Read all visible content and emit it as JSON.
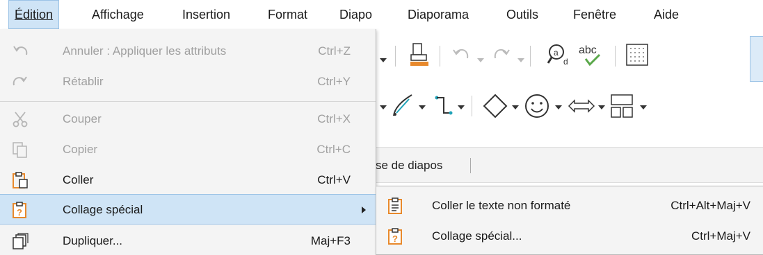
{
  "menubar": {
    "items": [
      {
        "label": "Édition"
      },
      {
        "label": "Affichage"
      },
      {
        "label": "Insertion"
      },
      {
        "label": "Format"
      },
      {
        "label": "Diapo"
      },
      {
        "label": "Diaporama"
      },
      {
        "label": "Outils"
      },
      {
        "label": "Fenêtre"
      },
      {
        "label": "Aide"
      }
    ]
  },
  "edit_menu": {
    "items": [
      {
        "label": "Annuler : Appliquer les attributs",
        "shortcut": "Ctrl+Z",
        "icon": "undo-icon",
        "enabled": false
      },
      {
        "label": "Rétablir",
        "shortcut": "Ctrl+Y",
        "icon": "redo-icon",
        "enabled": false
      },
      {
        "label": "Couper",
        "shortcut": "Ctrl+X",
        "icon": "cut-icon",
        "enabled": false
      },
      {
        "label": "Copier",
        "shortcut": "Ctrl+C",
        "icon": "copy-icon",
        "enabled": false
      },
      {
        "label": "Coller",
        "shortcut": "Ctrl+V",
        "icon": "paste-icon",
        "enabled": true
      },
      {
        "label": "Collage spécial",
        "shortcut": "",
        "icon": "paste-special-icon",
        "enabled": true,
        "highlighted": true,
        "has_submenu": true
      },
      {
        "label": "Dupliquer...",
        "shortcut": "Maj+F3",
        "icon": "duplicate-icon",
        "enabled": true
      }
    ]
  },
  "paste_special_submenu": {
    "items": [
      {
        "label": "Coller le texte non formaté",
        "shortcut": "Ctrl+Alt+Maj+V",
        "icon": "paste-unformatted-icon"
      },
      {
        "label": "Collage spécial...",
        "shortcut": "Ctrl+Maj+V",
        "icon": "paste-special-dialog-icon"
      }
    ]
  },
  "background": {
    "panel_text": "se de diapos"
  },
  "colors": {
    "highlight": "#cfe4f6",
    "highlight_border": "#9cc3e6",
    "menu_bg": "#f4f4f4",
    "disabled_text": "#a0a0a0",
    "icon_orange": "#e8892c",
    "icon_accent_green": "#5aa84a",
    "icon_teal": "#1fa3b8"
  }
}
